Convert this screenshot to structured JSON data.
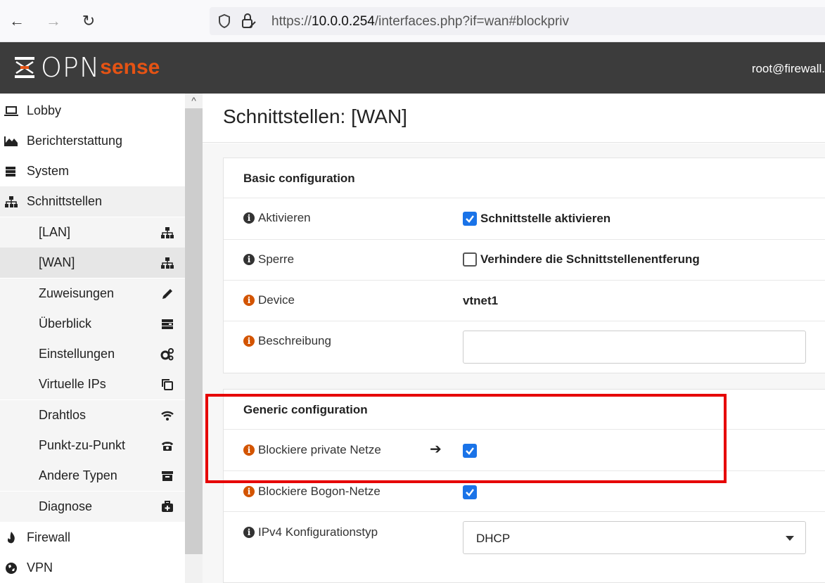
{
  "browser": {
    "url_prefix": "https://",
    "url_host": "10.0.0.254",
    "url_path": "/interfaces.php?if=wan#blockpriv"
  },
  "header": {
    "logo_main": "OPN",
    "logo_sub": "sense",
    "user": "root@firewall."
  },
  "sidebar": {
    "items": [
      {
        "label": "Lobby",
        "icon": "laptop-icon"
      },
      {
        "label": "Berichterstattung",
        "icon": "area-chart-icon"
      },
      {
        "label": "System",
        "icon": "server-icon"
      },
      {
        "label": "Schnittstellen",
        "icon": "sitemap-icon"
      }
    ],
    "subitems": [
      {
        "label": "[LAN]",
        "icon": "sitemap-icon"
      },
      {
        "label": "[WAN]",
        "icon": "sitemap-icon"
      },
      {
        "label": "Zuweisungen",
        "icon": "pencil-icon"
      },
      {
        "label": "Überblick",
        "icon": "tasks-icon"
      },
      {
        "label": "Einstellungen",
        "icon": "cogs-icon"
      },
      {
        "label": "Virtuelle IPs",
        "icon": "clone-icon"
      },
      {
        "label": "Drahtlos",
        "icon": "wifi-icon"
      },
      {
        "label": "Punkt-zu-Punkt",
        "icon": "phone-icon"
      },
      {
        "label": "Andere Typen",
        "icon": "archive-icon"
      },
      {
        "label": "Diagnose",
        "icon": "medkit-icon"
      }
    ],
    "bottom": [
      {
        "label": "Firewall",
        "icon": "fire-icon"
      },
      {
        "label": "VPN",
        "icon": "globe-icon"
      }
    ]
  },
  "main": {
    "title": "Schnittstellen: [WAN]",
    "basic": {
      "title": "Basic configuration",
      "enable_label": "Aktivieren",
      "enable_value": "Schnittstelle aktivieren",
      "enable_checked": true,
      "lock_label": "Sperre",
      "lock_value": "Verhindere die Schnittstellenentferung",
      "lock_checked": false,
      "device_label": "Device",
      "device_value": "vtnet1",
      "desc_label": "Beschreibung",
      "desc_value": ""
    },
    "generic": {
      "title": "Generic configuration",
      "blockpriv_label": "Blockiere private Netze",
      "blockpriv_checked": true,
      "blockbogon_label": "Blockiere Bogon-Netze",
      "blockbogon_checked": true,
      "ipv4_label": "IPv4 Konfigurationstyp",
      "ipv4_value": "DHCP"
    }
  },
  "colors": {
    "accent": "#1a73e8",
    "brand": "#e55314",
    "highlight": "#e60000"
  }
}
